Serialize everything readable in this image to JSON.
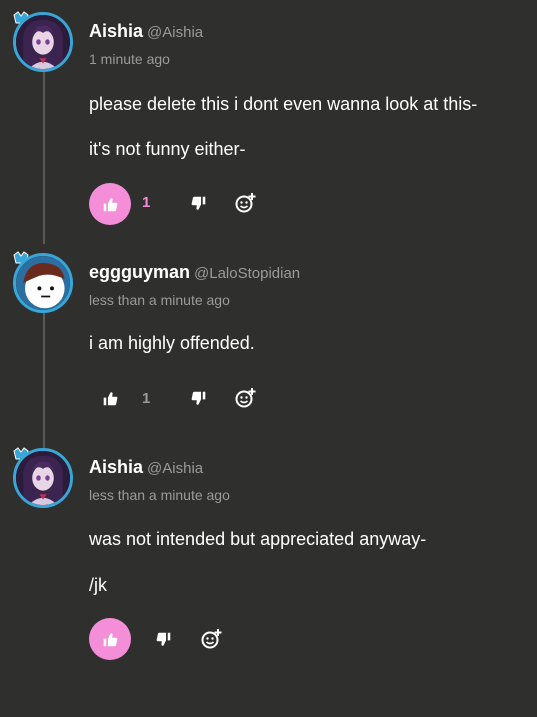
{
  "colors": {
    "background": "#2f302e",
    "accent_pink": "#f58ed8",
    "avatar_ring": "#39a6d8",
    "muted_text": "#9a9b99"
  },
  "comments": [
    {
      "display_name": "Aishia",
      "handle": "@Aishia",
      "timestamp": "1 minute ago",
      "avatar_icon": "anime-girl-avatar-icon",
      "body": [
        "please delete this i dont even wanna look at this-",
        "it's not funny either-"
      ],
      "likes": "1",
      "liked": true
    },
    {
      "display_name": "eggguyman",
      "handle": "@LaloStopidian",
      "timestamp": "less than a minute ago",
      "avatar_icon": "cartoon-egg-face-avatar-icon",
      "body": [
        "i am highly offended."
      ],
      "likes": "1",
      "liked": false
    },
    {
      "display_name": "Aishia",
      "handle": "@Aishia",
      "timestamp": "less than a minute ago",
      "avatar_icon": "anime-girl-avatar-icon",
      "body": [
        "was not intended but appreciated anyway-",
        "/jk"
      ],
      "likes": "",
      "liked": true
    }
  ]
}
